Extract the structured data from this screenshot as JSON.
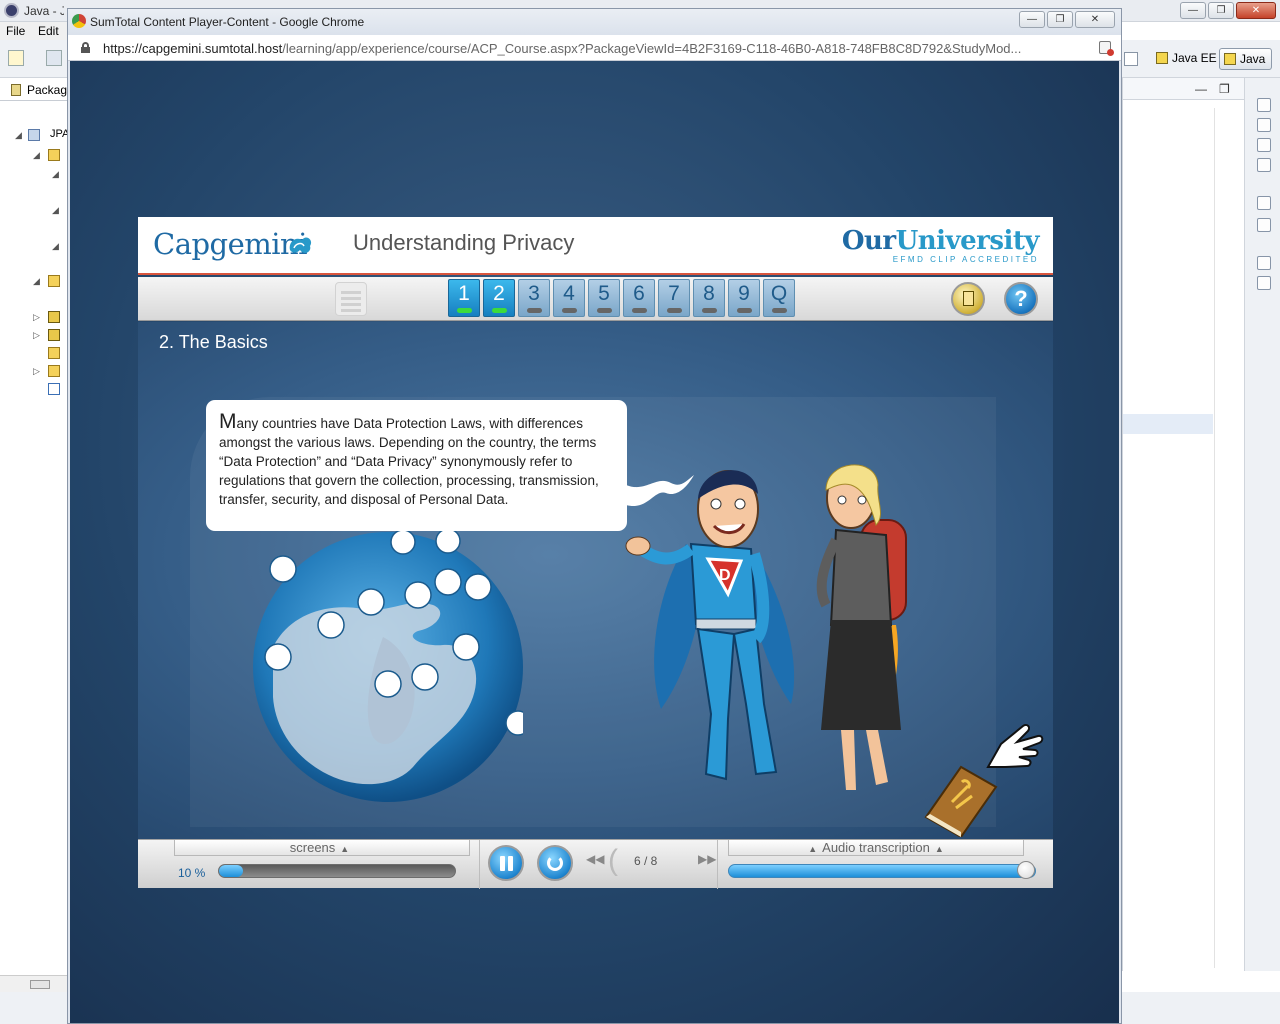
{
  "ide": {
    "title": "Java - JPA/Libr...",
    "menu": {
      "file": "File",
      "edit": "Edit"
    },
    "package_tab": "Packag",
    "tree_label": "JPA",
    "perspectives": {
      "java_ee": "Java EE",
      "java": "Java"
    }
  },
  "chrome": {
    "window_title": "SumTotal Content Player-Content - Google Chrome",
    "url_host": "https://capgemini.sumtotal.host",
    "url_path": "/learning/app/experience/course/ACP_Course.aspx?PackageViewId=4B2F3169-C118-46B0-A818-748FB8C8D792&StudyMod..."
  },
  "course": {
    "brand": "Capgemini",
    "title": "Understanding Privacy",
    "partner_logo": {
      "main_a": "Our",
      "main_b": "University",
      "sub": "EFMD CLIP ACCREDITED"
    },
    "tabs": [
      {
        "label": "1",
        "state": "done"
      },
      {
        "label": "2",
        "state": "current"
      },
      {
        "label": "3",
        "state": "pending"
      },
      {
        "label": "4",
        "state": "pending"
      },
      {
        "label": "5",
        "state": "pending"
      },
      {
        "label": "6",
        "state": "pending"
      },
      {
        "label": "7",
        "state": "pending"
      },
      {
        "label": "8",
        "state": "pending"
      },
      {
        "label": "9",
        "state": "pending"
      },
      {
        "label": "Q",
        "state": "pending"
      }
    ],
    "help_label": "?",
    "section_title": "2. The Basics",
    "bubble_first_letter": "M",
    "bubble_text": "any countries have Data Protection Laws, with differences amongst the various laws. Depending on the country, the terms “Data Protection” and “Data Privacy” synonymously refer to regulations that govern the collection, processing, transmission, transfer, security, and disposal of Personal Data.",
    "footer": {
      "screens_label": "screens",
      "progress_text": "10 %",
      "progress_fraction": 0.1,
      "counter": "6 / 8",
      "audio_label": "Audio transcription",
      "audio_fraction": 0.95
    }
  },
  "colors": {
    "brand_blue": "#1f6aa4",
    "accent_red": "#d9553d",
    "tab_active": "#1f8fd0",
    "background": "#234569"
  }
}
